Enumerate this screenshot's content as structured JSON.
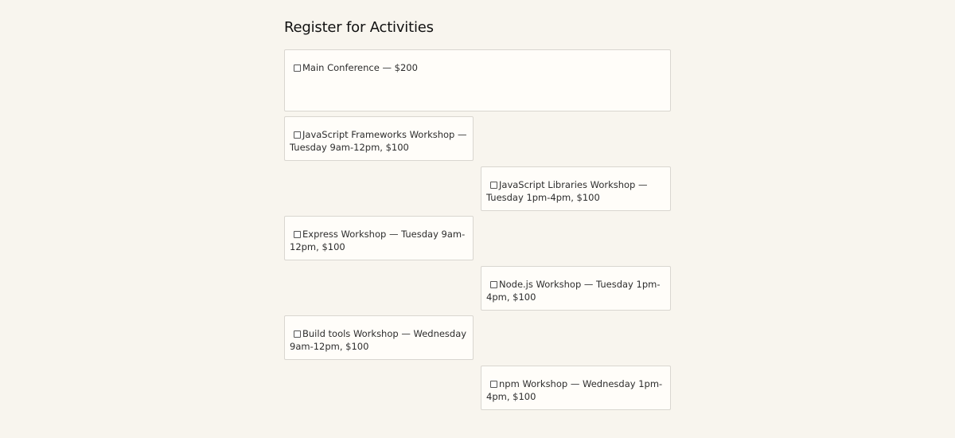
{
  "page": {
    "title": "Register for Activities"
  },
  "activities": [
    {
      "label": "Main Conference — $200",
      "checked": false
    },
    {
      "label": "JavaScript Frameworks Workshop — Tuesday 9am-12pm, $100",
      "checked": false
    },
    {
      "label": "JavaScript Libraries Workshop — Tuesday 1pm-4pm, $100",
      "checked": false
    },
    {
      "label": "Express Workshop — Tuesday 9am-12pm, $100",
      "checked": false
    },
    {
      "label": "Node.js Workshop — Tuesday 1pm-4pm, $100",
      "checked": false
    },
    {
      "label": "Build tools Workshop — Wednesday 9am-12pm, $100",
      "checked": false
    },
    {
      "label": "npm Workshop — Wednesday 1pm-4pm, $100",
      "checked": false
    }
  ]
}
